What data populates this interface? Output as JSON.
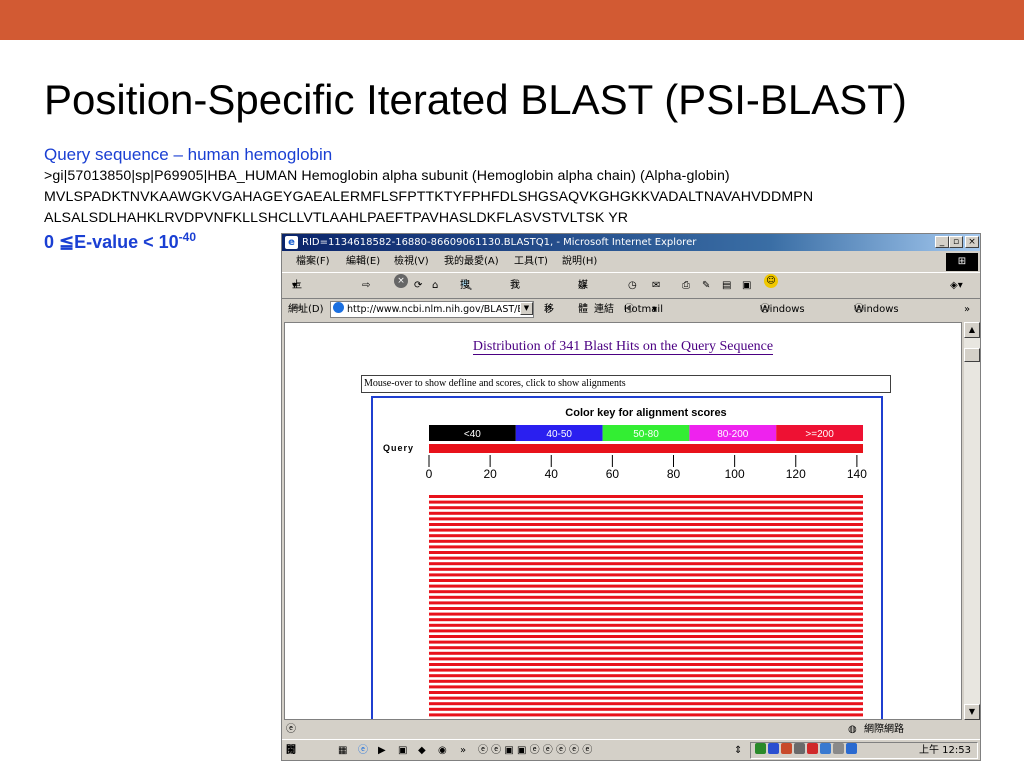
{
  "slide": {
    "title": "Position-Specific Iterated BLAST (PSI-BLAST)",
    "query_heading": "Query sequence – human hemoglobin",
    "fasta_header": ">gi|57013850|sp|P69905|HBA_HUMAN Hemoglobin alpha subunit (Hemoglobin alpha chain) (Alpha-globin)",
    "sequence_line1": "MVLSPADKTNVKAAWGKVGAHAGEYGAEALERMFLSFPTTKTYFPHFDLSHGSAQVKGHGKKVADALTNAVAHVDDMPN",
    "sequence_line2": "ALSALSDLHAHKLRVDPVNFKLLSHCLLVTLAAHLPAEFTPAVHASLDKFLASVSTVLTSK YR",
    "evalue_base": "0 ≦E-value < 10",
    "evalue_exp": "-40"
  },
  "colors": {
    "accent_bar": "#D25A33",
    "link_blue": "#1a3fd3",
    "hit_red": "#E8121B"
  },
  "window": {
    "title": "RID=1134618582-16880-86609061130.BLASTQ1, - Microsoft Internet Explorer",
    "minimize": "_",
    "restore": "▫",
    "close": "×"
  },
  "menu": {
    "file": "檔案(F)",
    "edit": "編輯(E)",
    "view": "檢視(V)",
    "favorites": "我的最愛(A)",
    "tools": "工具(T)",
    "help": "說明(H)"
  },
  "toolbar": {
    "back": "上一頁",
    "search": "搜尋",
    "favorites": "我的最愛",
    "media": "媒體"
  },
  "address": {
    "label": "網址(D)",
    "url": "http://www.ncbi.nlm.nih.gov/BLAST/Blas",
    "go": "移至",
    "links": "連結",
    "link1": "Hotmail 的免費電子郵件",
    "link2": "Windows Media",
    "link3": "Windows"
  },
  "page": {
    "distribution_title": "Distribution of 341 Blast Hits on the Query Sequence",
    "mouse_over_hint": "Mouse-over to show defline and scores, click to show alignments",
    "color_key_title": "Color key for alignment scores",
    "query_label": "Query",
    "color_key": [
      {
        "label": "<40",
        "color": "#000000",
        "text": "#ffffff"
      },
      {
        "label": "40-50",
        "color": "#2a1ff0",
        "text": "#ffffff"
      },
      {
        "label": "50-80",
        "color": "#33ee33",
        "text": "#ffffff"
      },
      {
        "label": "80-200",
        "color": "#ee22ee",
        "text": "#ffffff"
      },
      {
        "label": ">=200",
        "color": "#ee1133",
        "text": "#ffffff"
      }
    ],
    "axis_ticks": [
      "0",
      "20",
      "40",
      "60",
      "80",
      "100",
      "120",
      "140"
    ]
  },
  "chart_data": {
    "type": "bar",
    "title": "Distribution of 341 Blast Hits on the Query Sequence",
    "x_ticks": [
      0,
      20,
      40,
      60,
      80,
      100,
      120,
      140
    ],
    "xlim": [
      0,
      142
    ],
    "query_length": 142,
    "visible_hit_count": 40,
    "hit_score_class": ">=200",
    "hits_start": 0,
    "hits_end": 142
  },
  "statusbar": {
    "zone": "網際網路"
  },
  "taskbar": {
    "start": "開始",
    "chevron": "»",
    "clock": "上午 12:53"
  }
}
